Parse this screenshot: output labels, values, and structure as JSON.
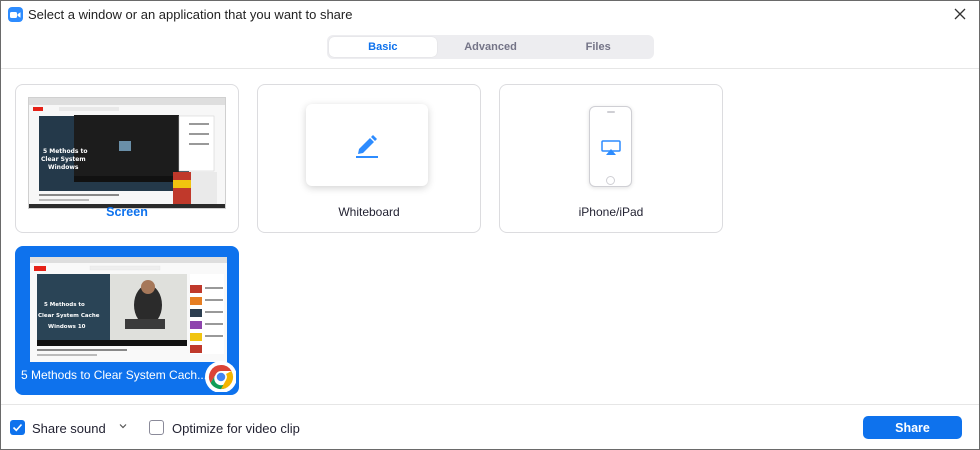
{
  "window": {
    "title": "Select a window or an application that you want to share"
  },
  "tabs": [
    {
      "label": "Basic",
      "active": true
    },
    {
      "label": "Advanced",
      "active": false
    },
    {
      "label": "Files",
      "active": false
    }
  ],
  "tiles": {
    "screen": {
      "label": "Screen"
    },
    "whiteboard": {
      "label": "Whiteboard"
    },
    "iphone": {
      "label": "iPhone/iPad"
    },
    "chrome_window": {
      "label": "5 Methods to Clear System Cach..."
    }
  },
  "thumbnails": {
    "video_title_small": "5 Methods to Clear System Cache Windows",
    "video_title_large_line1": "5 Methods to",
    "video_title_large_line2": "Clear System Cache",
    "video_title_large_line3": "Windows 10"
  },
  "bottom": {
    "share_sound_label": "Share sound",
    "share_sound_checked": true,
    "optimize_label": "Optimize for video clip",
    "optimize_checked": false,
    "share_button": "Share"
  },
  "colors": {
    "accent": "#0e72ed",
    "zoom_blue": "#2d8cff"
  }
}
